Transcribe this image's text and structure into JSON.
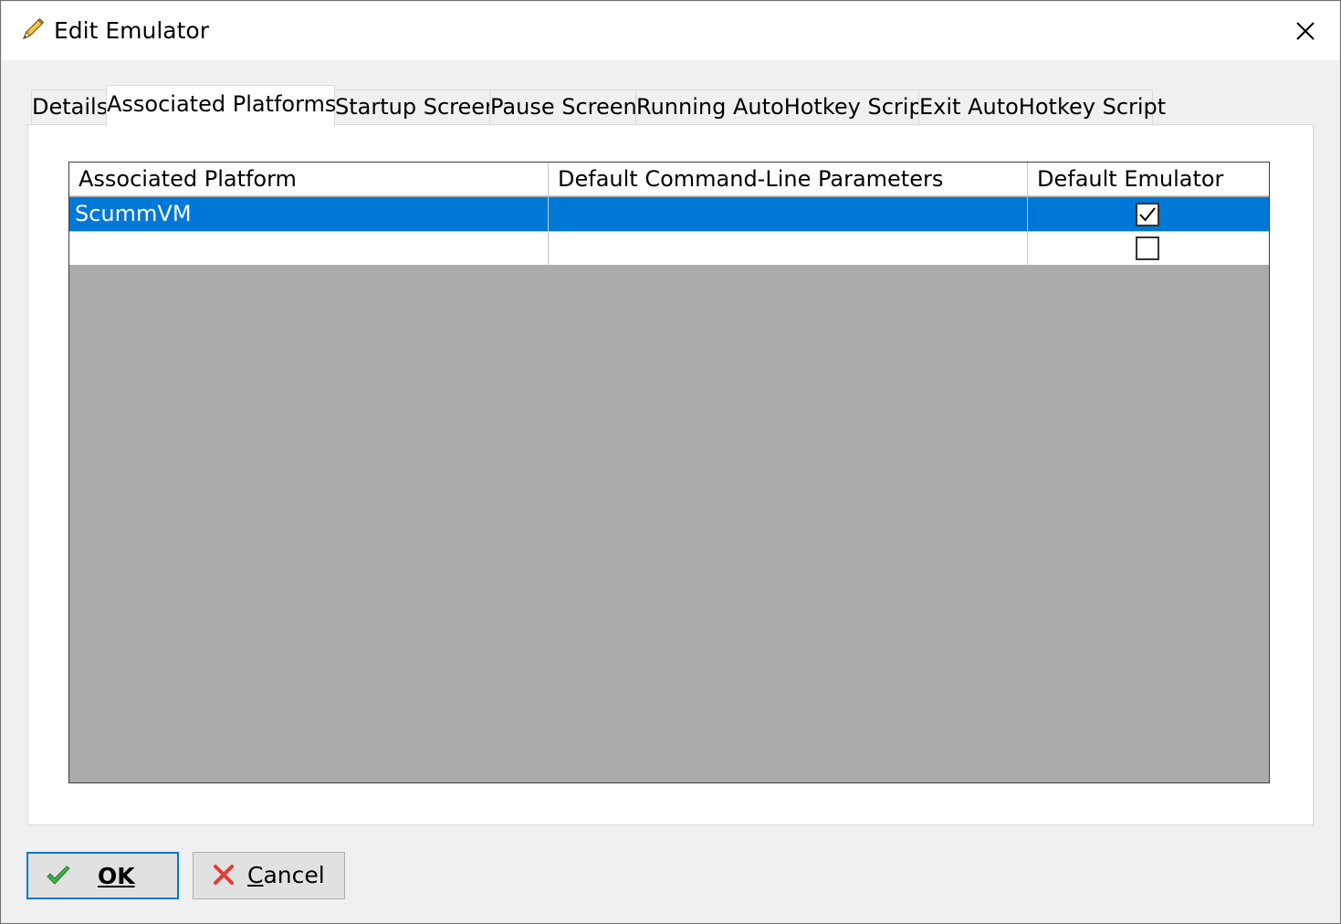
{
  "window": {
    "title": "Edit Emulator",
    "title_icon": "pencil-icon",
    "close_icon": "close-icon"
  },
  "tabs": [
    {
      "label": "Details",
      "active": false
    },
    {
      "label": "Associated Platforms",
      "active": true
    },
    {
      "label": "Startup Screen",
      "active": false
    },
    {
      "label": "Pause Screen",
      "active": false
    },
    {
      "label": "Running AutoHotkey Script",
      "active": false
    },
    {
      "label": "Exit AutoHotkey Script",
      "active": false
    }
  ],
  "grid": {
    "columns": [
      "Associated Platform",
      "Default Command-Line Parameters",
      "Default Emulator"
    ],
    "rows": [
      {
        "platform": "ScummVM",
        "params": "",
        "default_emulator": true,
        "selected": true
      },
      {
        "platform": "",
        "params": "",
        "default_emulator": false,
        "selected": false
      }
    ]
  },
  "buttons": {
    "ok_label": "OK",
    "cancel_label": "Cancel",
    "ok_icon": "checkmark-icon",
    "cancel_icon": "x-icon"
  },
  "colors": {
    "selection": "#0078d7",
    "grid_background": "#ababab"
  }
}
